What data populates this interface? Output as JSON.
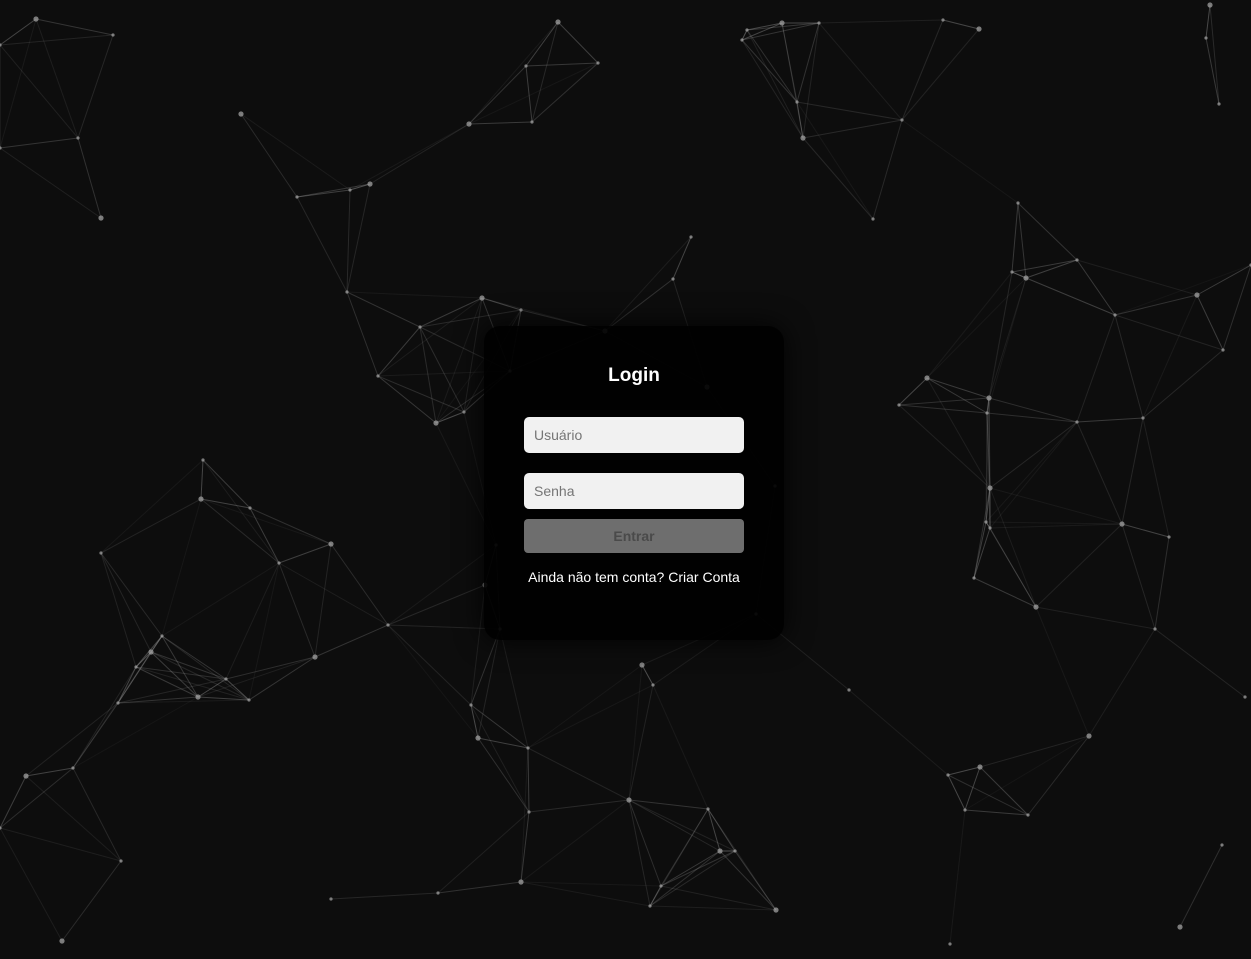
{
  "login": {
    "title": "Login",
    "username_placeholder": "Usuário",
    "password_placeholder": "Senha",
    "submit_label": "Entrar",
    "signup_prompt": "Ainda não tem conta?",
    "signup_link": "Criar Conta"
  },
  "colors": {
    "page_background": "#0d0d0d",
    "card_background": "#000000",
    "input_background": "#f1f1f1",
    "button_background": "#6e6e6e",
    "network_lines": "#a0a0a0"
  }
}
